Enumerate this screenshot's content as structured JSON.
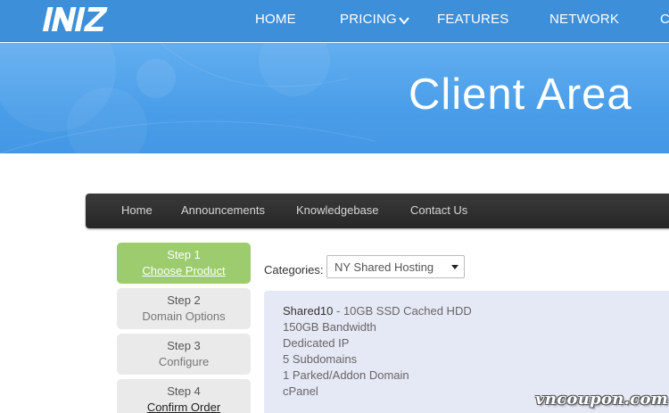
{
  "header": {
    "logo_text": "INIZ",
    "nav": {
      "home": "HOME",
      "pricing": "PRICING",
      "features": "FEATURES",
      "network": "NETWORK",
      "cut": "C"
    }
  },
  "hero": {
    "title": "Client Area"
  },
  "client_nav": {
    "home": "Home",
    "announcements": "Announcements",
    "knowledgebase": "Knowledgebase",
    "contact": "Contact Us"
  },
  "steps": [
    {
      "num": "Step 1",
      "label": "Choose Product"
    },
    {
      "num": "Step 2",
      "label": "Domain Options"
    },
    {
      "num": "Step 3",
      "label": "Configure"
    },
    {
      "num": "Step 4",
      "label": "Confirm Order"
    }
  ],
  "categories": {
    "label": "Categories:",
    "selected": "NY Shared Hosting"
  },
  "product": {
    "name": "Shared10",
    "desc": " - 10GB SSD Cached HDD",
    "features": [
      "150GB Bandwidth",
      "Dedicated IP",
      "5 Subdomains",
      "1 Parked/Addon Domain",
      "cPanel"
    ]
  },
  "watermark": "vncoupon.com",
  "colors": {
    "topbar": "#3d8fd9",
    "hero": "#4a9ee9",
    "active_step": "#9ccc6e",
    "product_box": "#e4e9f5"
  }
}
